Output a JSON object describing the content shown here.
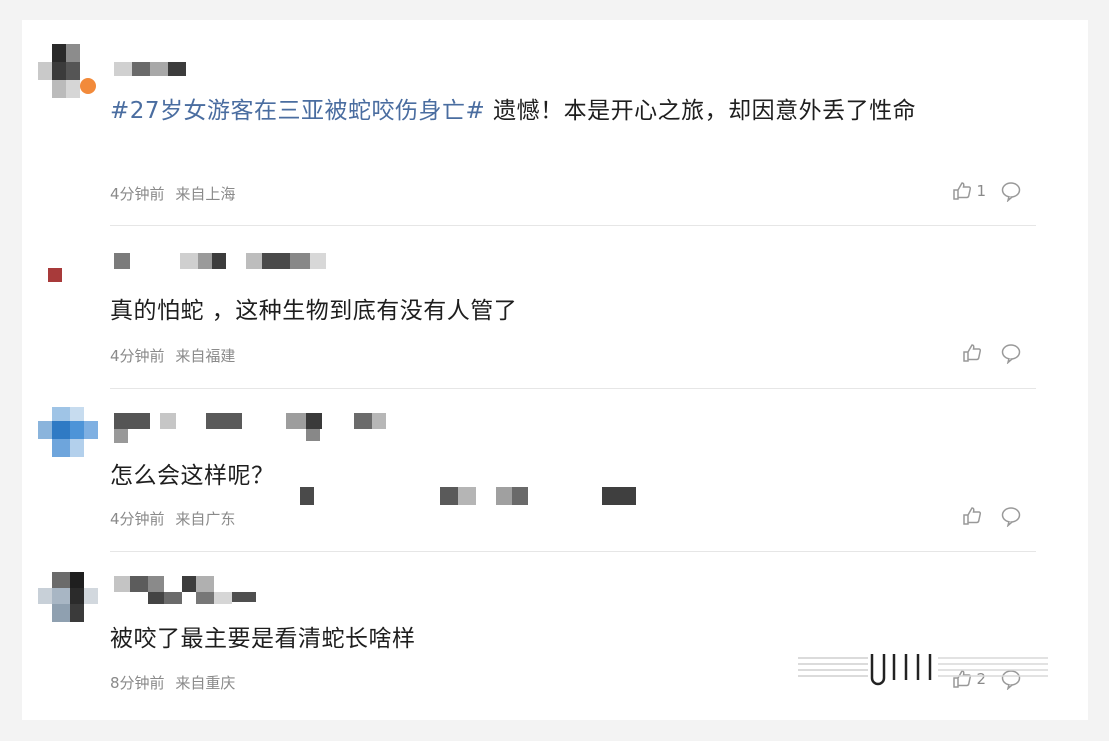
{
  "comments": [
    {
      "topic": "#27岁女游客在三亚被蛇咬伤身亡#",
      "text": " 遗憾！本是开心之旅，却因意外丢了性命",
      "time": "4分钟前",
      "location": "来自上海",
      "likes": "1"
    },
    {
      "topic": "",
      "text": "真的怕蛇 ，这种生物到底有没有人管了",
      "time": "4分钟前",
      "location": "来自福建",
      "likes": ""
    },
    {
      "topic": "",
      "text": "怎么会这样呢？",
      "time": "4分钟前",
      "location": "来自广东",
      "likes": ""
    },
    {
      "topic": "",
      "text": "被咬了最主要是看清蛇长啥样",
      "time": "8分钟前",
      "location": "来自重庆",
      "likes": "2"
    }
  ],
  "icons": {
    "like": "thumbs-up-icon",
    "reply": "comment-bubble-icon"
  },
  "colors": {
    "topic": "#4a6da0",
    "meta": "#8a8a8a",
    "text": "#1e1e1e"
  }
}
